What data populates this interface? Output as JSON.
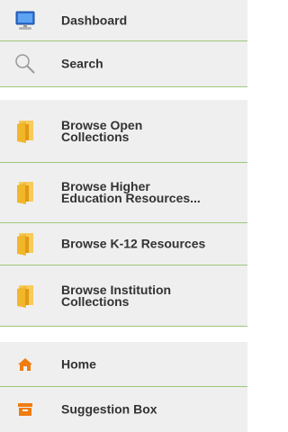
{
  "colors": {
    "item_bg": "#efefef",
    "divider": "#9bc97a",
    "text": "#333333",
    "folder": "#f2b62a",
    "accent_orange": "#f07d10"
  },
  "menu": {
    "dashboard": {
      "label": "Dashboard",
      "icon": "monitor-icon"
    },
    "search": {
      "label": "Search",
      "icon": "search-icon"
    },
    "browse_open": {
      "label": "Browse Open\nCollections",
      "icon": "folder-icon"
    },
    "browse_higher_ed": {
      "label": "Browse Higher\nEducation Resources...",
      "icon": "folder-icon"
    },
    "browse_k12": {
      "label": "Browse K-12 Resources",
      "icon": "folder-icon"
    },
    "browse_institution": {
      "label": "Browse Institution\nCollections",
      "icon": "folder-icon"
    },
    "home": {
      "label": "Home",
      "icon": "home-icon"
    },
    "suggestion_box": {
      "label": "Suggestion Box",
      "icon": "archive-box-icon"
    }
  }
}
